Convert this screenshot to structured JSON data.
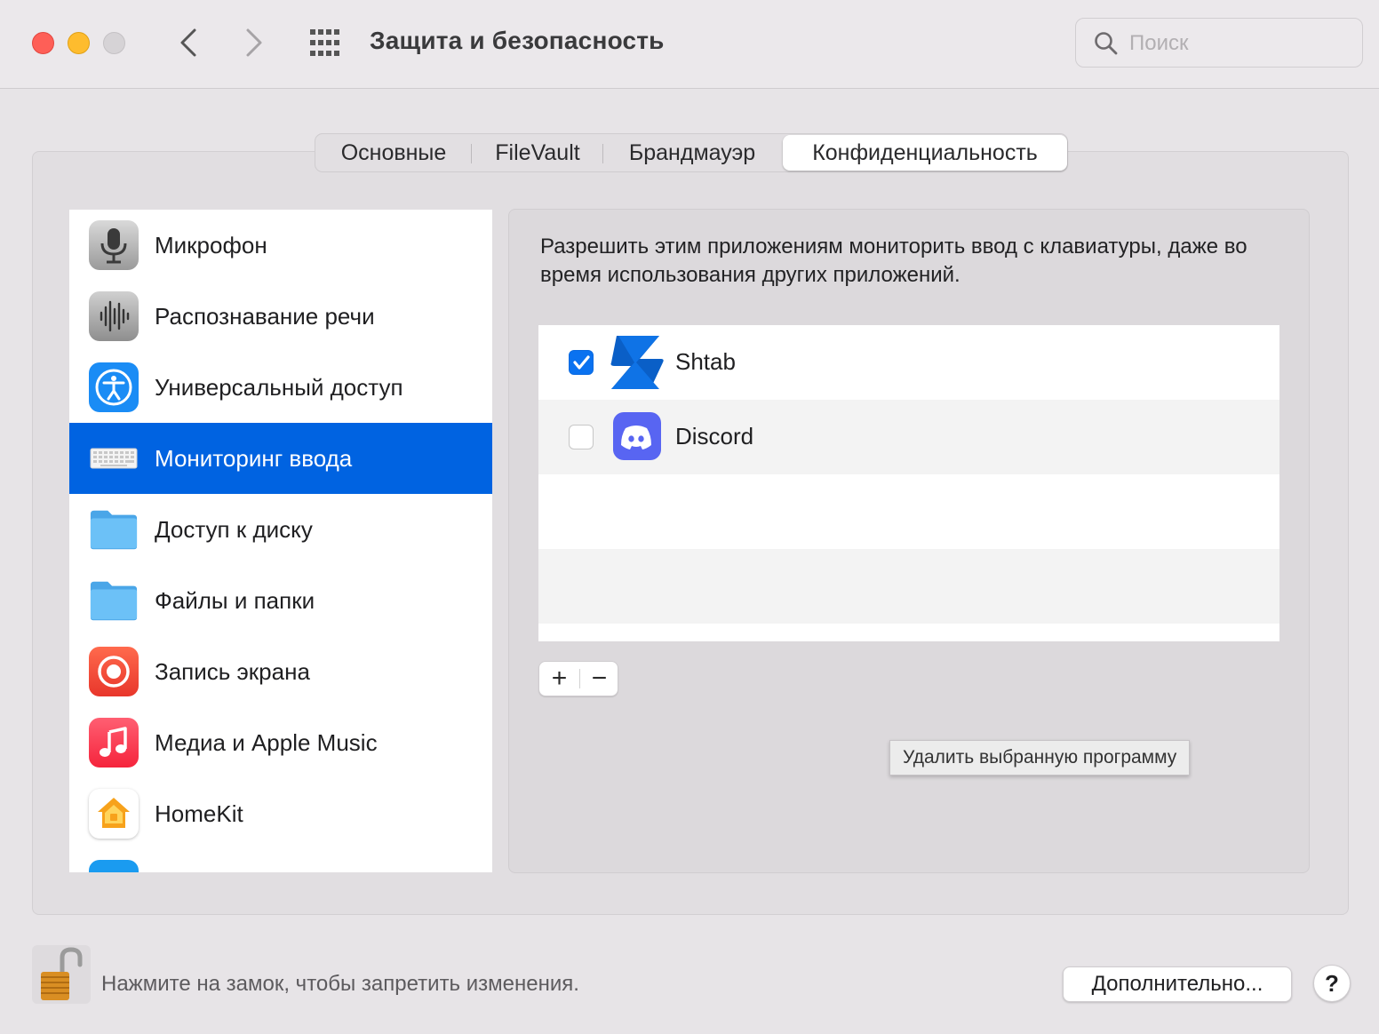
{
  "window": {
    "title": "Защита и безопасность",
    "search_placeholder": "Поиск"
  },
  "tabs": [
    {
      "label": "Основные",
      "selected": false
    },
    {
      "label": "FileVault",
      "selected": false
    },
    {
      "label": "Брандмауэр",
      "selected": false
    },
    {
      "label": "Конфиденциальность",
      "selected": true
    }
  ],
  "sidebar": {
    "items": [
      {
        "label": "Микрофон",
        "icon": "microphone-icon",
        "selected": false
      },
      {
        "label": "Распознавание речи",
        "icon": "waveform-icon",
        "selected": false
      },
      {
        "label": "Универсальный доступ",
        "icon": "accessibility-icon",
        "selected": false
      },
      {
        "label": "Мониторинг ввода",
        "icon": "keyboard-icon",
        "selected": true
      },
      {
        "label": "Доступ к диску",
        "icon": "folder-icon",
        "selected": false
      },
      {
        "label": "Файлы и папки",
        "icon": "folder-icon",
        "selected": false
      },
      {
        "label": "Запись экрана",
        "icon": "screen-record-icon",
        "selected": false
      },
      {
        "label": "Медиа и Apple Music",
        "icon": "music-note-icon",
        "selected": false
      },
      {
        "label": "HomeKit",
        "icon": "home-icon",
        "selected": false
      }
    ]
  },
  "content": {
    "description": "Разрешить этим приложениям мониторить ввод с клавиатуры, даже во время использования других приложений.",
    "apps": [
      {
        "name": "Shtab",
        "checked": true,
        "icon": "shtab-logo-icon"
      },
      {
        "name": "Discord",
        "checked": false,
        "icon": "discord-logo-icon"
      }
    ],
    "add_label": "+",
    "remove_label": "−",
    "tooltip": "Удалить выбранную программу"
  },
  "footer": {
    "lock_text": "Нажмите на замок, чтобы запретить изменения.",
    "advanced_label": "Дополнительно...",
    "help_label": "?"
  },
  "colors": {
    "selection": "#0063e1",
    "checkbox_checked": "#0a72f0",
    "traffic_close": "#fe5f57",
    "traffic_min": "#febc2e"
  }
}
